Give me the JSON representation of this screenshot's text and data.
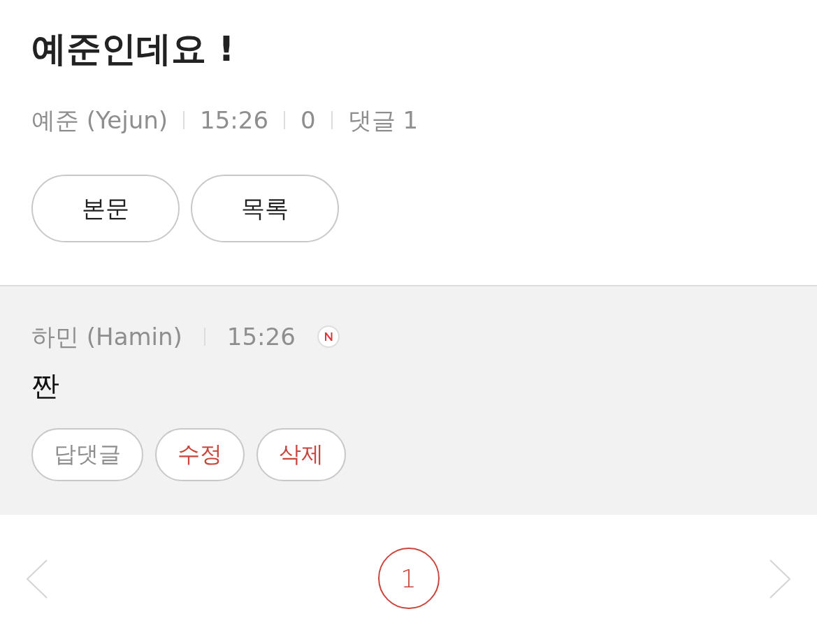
{
  "post": {
    "title": "예준인데요 !",
    "meta": [
      "예준 (Yejun)",
      "15:26",
      "0",
      "댓글 1"
    ],
    "buttons": [
      "본문",
      "목록"
    ]
  },
  "comments": [
    {
      "author": "하민 (Hamin)",
      "time": "15:26",
      "new": true,
      "body": "짠",
      "actions": [
        {
          "label": "답댓글",
          "kind": "reply"
        },
        {
          "label": "수정",
          "kind": "edit"
        },
        {
          "label": "삭제",
          "kind": "delete"
        }
      ]
    }
  ],
  "pagination": {
    "prev_disabled": true,
    "pages": [
      {
        "label": "1",
        "selected": true
      }
    ],
    "next_disabled": true
  }
}
